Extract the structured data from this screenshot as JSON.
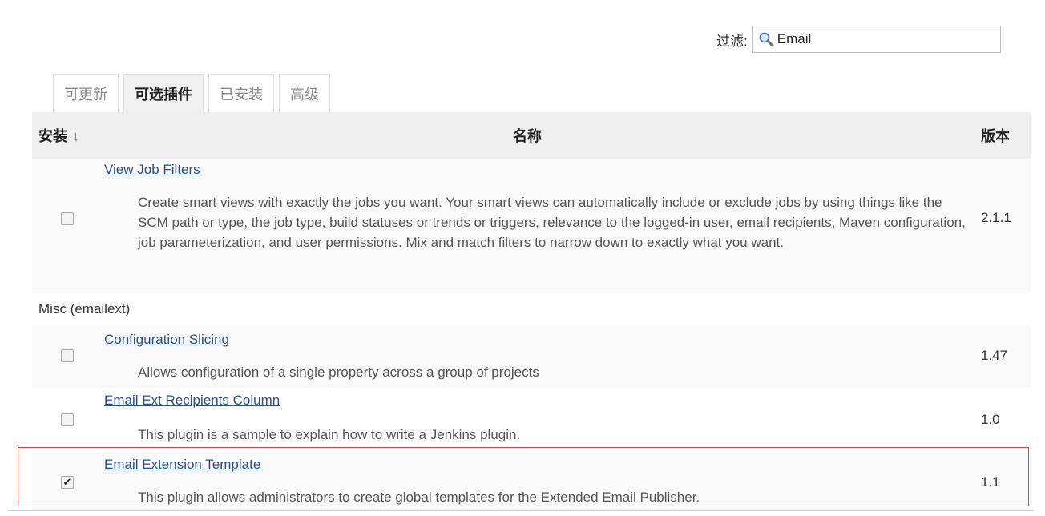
{
  "filter": {
    "label": "过滤:",
    "value": "Email"
  },
  "tabs": [
    {
      "label": "可更新",
      "active": false
    },
    {
      "label": "可选插件",
      "active": true
    },
    {
      "label": "已安装",
      "active": false
    },
    {
      "label": "高级",
      "active": false
    }
  ],
  "table": {
    "headers": {
      "install": "安装",
      "sort_arrow": "↓",
      "name": "名称",
      "version": "版本"
    },
    "rows": [
      {
        "name": "View Job Filters",
        "description": "Create smart views with exactly the jobs you want. Your smart views can automatically include or exclude jobs by using things like the SCM path or type, the job type, build statuses or trends or triggers, relevance to the logged-in user, email recipients, Maven configuration, job parameterization, and user permissions. Mix and match filters to narrow down to exactly what you want.",
        "version": "2.1.1",
        "checked": false
      }
    ],
    "category": "Misc (emailext)",
    "category_rows": [
      {
        "name": "Configuration Slicing",
        "description": "Allows configuration of a single property across a group of projects",
        "version": "1.47",
        "checked": false
      },
      {
        "name": "Email Ext Recipients Column",
        "description": "This plugin is a sample to explain how to write a Jenkins plugin.",
        "version": "1.0",
        "checked": false
      },
      {
        "name": "Email Extension Template",
        "description": "This plugin allows administrators to create global templates for the Extended Email Publisher.",
        "version": "1.1",
        "checked": true
      }
    ]
  },
  "icons": {
    "search": "magnifier-icon",
    "check": "✔"
  }
}
